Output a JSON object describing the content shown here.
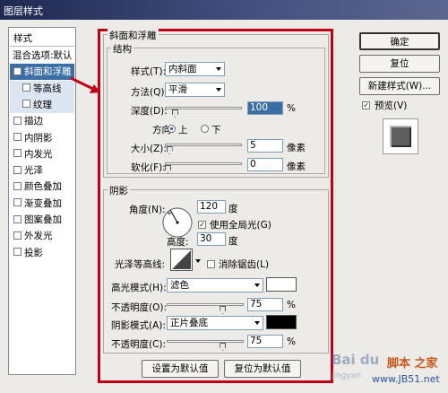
{
  "window": {
    "title": "图层样式"
  },
  "left_panel": {
    "header": "样式",
    "items": [
      {
        "label": "混合选项:默认",
        "checkbox": false
      },
      {
        "label": "斜面和浮雕",
        "checkbox": true,
        "checked": true,
        "selected": true
      },
      {
        "label": "等高线",
        "checkbox": true,
        "sub": true
      },
      {
        "label": "纹理",
        "checkbox": true,
        "sub": true
      },
      {
        "label": "描边",
        "checkbox": true
      },
      {
        "label": "内阴影",
        "checkbox": true
      },
      {
        "label": "内发光",
        "checkbox": true
      },
      {
        "label": "光泽",
        "checkbox": true
      },
      {
        "label": "颜色叠加",
        "checkbox": true
      },
      {
        "label": "渐变叠加",
        "checkbox": true
      },
      {
        "label": "图案叠加",
        "checkbox": true
      },
      {
        "label": "外发光",
        "checkbox": true
      },
      {
        "label": "投影",
        "checkbox": true
      }
    ]
  },
  "bevel": {
    "title": "斜面和浮雕",
    "structure": {
      "title": "结构",
      "style_label": "样式(T):",
      "style_value": "内斜面",
      "technique_label": "方法(Q):",
      "technique_value": "平滑",
      "depth_label": "深度(D):",
      "depth_value": "100",
      "depth_unit": "%",
      "depth_level": 0.1,
      "direction_label": "方向:",
      "dir_up": "上",
      "dir_down": "下",
      "size_label": "大小(Z):",
      "size_value": "5",
      "size_unit": "像素",
      "size_level": 0.02,
      "soften_label": "软化(F):",
      "soften_value": "0",
      "soften_unit": "像素",
      "soften_level": 0
    }
  },
  "shading": {
    "title": "阴影",
    "angle_label": "角度(N):",
    "angle_value": "120",
    "angle_unit": "度",
    "global_light_label": "使用全局光(G)",
    "altitude_label": "高度:",
    "altitude_value": "30",
    "altitude_unit": "度",
    "gloss_label": "光泽等高线:",
    "antialias_label": "消除锯齿(L)",
    "highlight_label": "高光模式(H):",
    "highlight_value": "滤色",
    "highlight_color": "#ffffff",
    "hl_opacity_label": "不透明度(O):",
    "hl_opacity_value": "75",
    "hl_opacity_level": 0.75,
    "shadow_label": "阴影模式(A):",
    "shadow_value": "正片叠底",
    "shadow_color": "#000000",
    "sh_opacity_label": "不透明度(C):",
    "sh_opacity_value": "75",
    "sh_opacity_level": 0.75,
    "pct": "%"
  },
  "buttons": {
    "set_default": "设置为默认值",
    "reset_default": "复位为默认值",
    "ok": "确定",
    "reset": "复位",
    "new_style": "新建样式(W)...",
    "preview": "预览(V)"
  },
  "watermark": {
    "brand1": "Bai du",
    "brand2": "脚本 之家",
    "brand3": "www.JB51.net",
    "brand4": "jingyan"
  },
  "colors": {
    "accent_red": "#c00018",
    "arrow": "#c00018",
    "selection": "#3a6ea5"
  }
}
